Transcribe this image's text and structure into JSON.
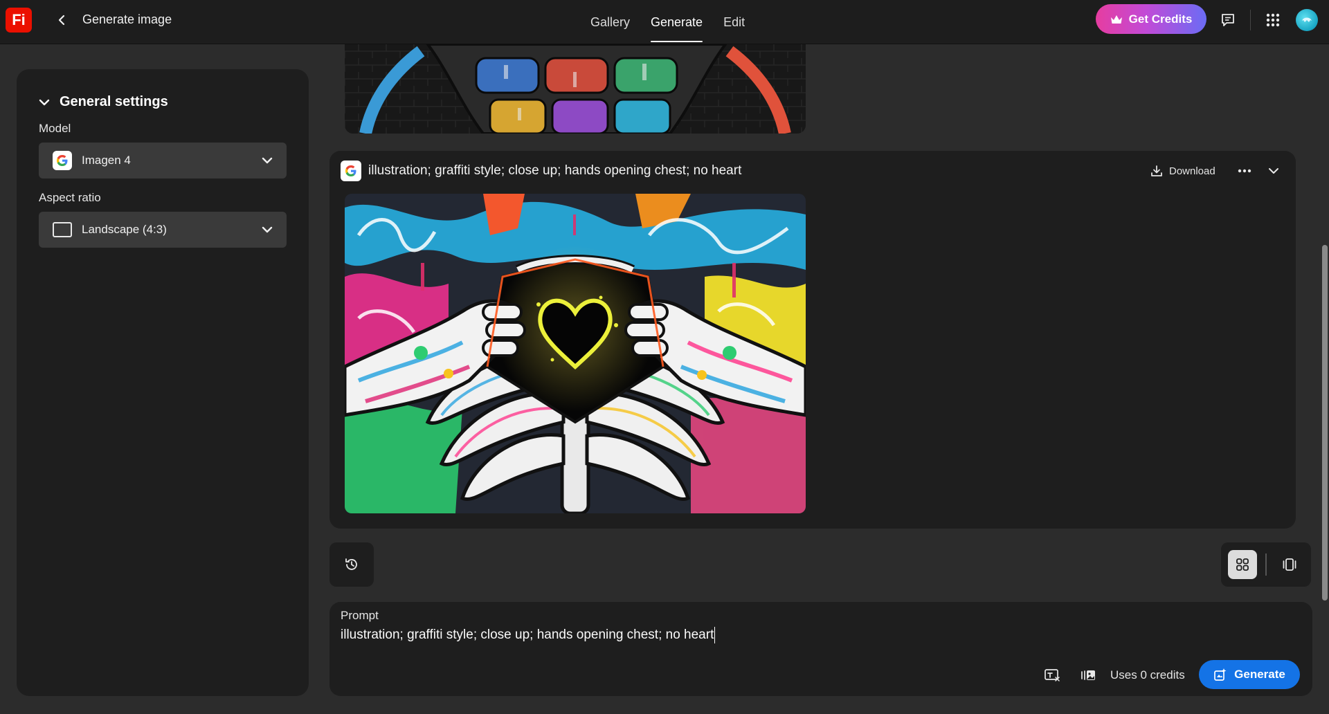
{
  "app": {
    "logo_text": "Fi",
    "page_title": "Generate image",
    "brand_color": "#eb1000"
  },
  "nav": {
    "tabs": [
      {
        "label": "Gallery",
        "active": false
      },
      {
        "label": "Generate",
        "active": true
      },
      {
        "label": "Edit",
        "active": false
      }
    ]
  },
  "header": {
    "credits_button": "Get Credits",
    "icons": [
      "crown-icon",
      "feedback-icon",
      "app-grid-icon",
      "avatar"
    ]
  },
  "settings": {
    "section_title": "General settings",
    "model": {
      "label": "Model",
      "value": "Imagen 4",
      "icon": "google-g-icon"
    },
    "aspect_ratio": {
      "label": "Aspect ratio",
      "value": "Landscape (4:3)",
      "icon": "landscape-ratio-icon"
    }
  },
  "result": {
    "prompt": "illustration; graffiti style; close up; hands opening chest; no heart",
    "download_label": "Download",
    "image_subject": "graffiti ribcage with hands opening chest and glowing heart outline"
  },
  "prompt_panel": {
    "label": "Prompt",
    "value": "illustration; graffiti style; close up; hands opening chest; no heart",
    "credits_note": "Uses 0 credits",
    "generate_label": "Generate"
  },
  "colors": {
    "accent_blue": "#1473e6",
    "credits_gradient": [
      "#e63da0",
      "#6b6cf5"
    ],
    "panel_bg": "#1e1e1e",
    "page_bg": "#2c2c2c"
  }
}
